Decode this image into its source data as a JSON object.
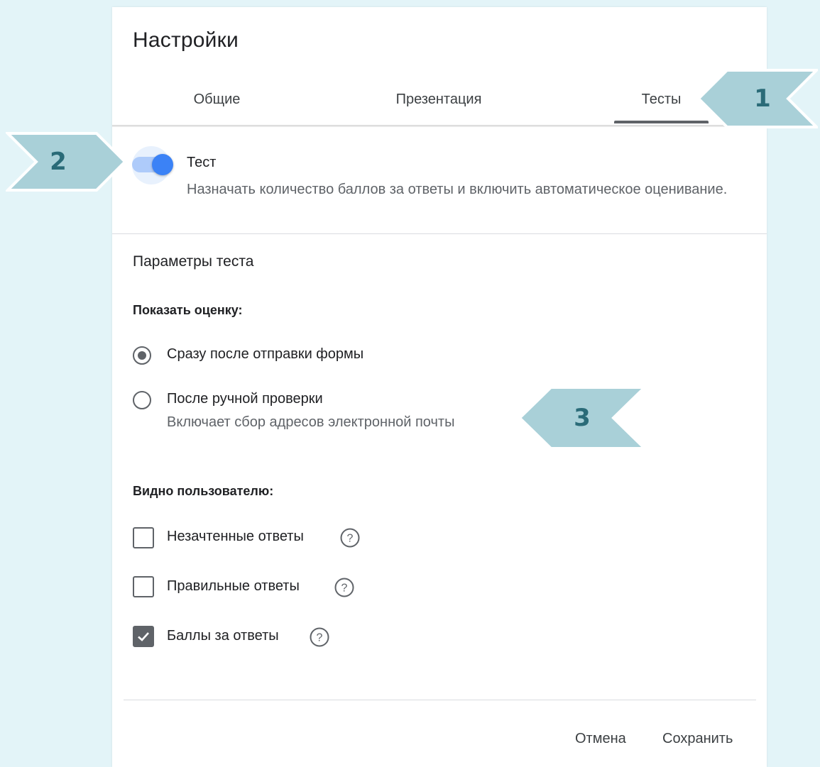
{
  "dialog": {
    "title": "Настройки"
  },
  "tabs": [
    {
      "label": "Общие",
      "active": false
    },
    {
      "label": "Презентация",
      "active": false
    },
    {
      "label": "Тесты",
      "active": true
    }
  ],
  "quiz_toggle": {
    "label": "Тест",
    "description": "Назначать количество баллов за ответы и включить автоматическое оценивание.",
    "enabled": true
  },
  "quiz_params": {
    "title": "Параметры теста",
    "show_grade": {
      "heading": "Показать оценку:",
      "options": [
        {
          "label": "Сразу после отправки формы",
          "selected": true
        },
        {
          "label": "После ручной проверки",
          "sub": "Включает сбор адресов электронной почты",
          "selected": false
        }
      ]
    },
    "visible_to_user": {
      "heading": "Видно пользователю:",
      "items": [
        {
          "label": "Незачтенные ответы",
          "checked": false
        },
        {
          "label": "Правильные ответы",
          "checked": false
        },
        {
          "label": "Баллы за ответы",
          "checked": true
        }
      ]
    }
  },
  "footer": {
    "cancel_label": "Отмена",
    "save_label": "Сохранить"
  },
  "callouts": {
    "one": "1",
    "two": "2",
    "three": "3"
  },
  "colors": {
    "background": "#e3f4f8",
    "callout_fill": "#a9d0d8",
    "callout_text": "#2a6b78",
    "toggle_knob": "#3b82f6",
    "toggle_track": "#aecbfa",
    "control_gray": "#5f6368"
  },
  "icons": {
    "help": "help-circle-icon",
    "check": "checkmark-icon"
  }
}
